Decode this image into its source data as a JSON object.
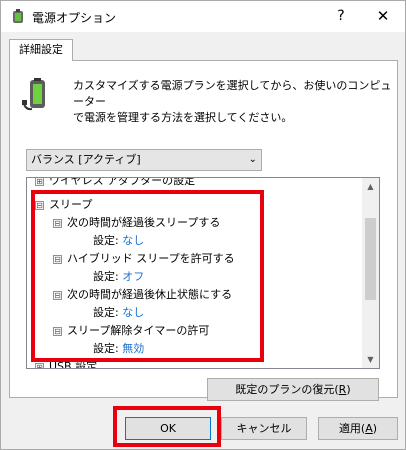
{
  "window": {
    "title": "電源オプション",
    "help_glyph": "?",
    "close_glyph": "✕"
  },
  "tab": {
    "label": "詳細設定"
  },
  "description": {
    "line1": "カスタマイズする電源プランを選択してから、お使いのコンピューター",
    "line2": "で電源を管理する方法を選択してください。"
  },
  "plan_select": {
    "value": "バランス [アクティブ]"
  },
  "tree": {
    "top_partial": "ワイヤレス アダプターの設定",
    "group_label": "スリープ",
    "setting_prefix": "設定:",
    "items": [
      {
        "label": "次の時間が経過後スリープする",
        "value": "なし"
      },
      {
        "label": "ハイブリッド スリープを許可する",
        "value": "オフ"
      },
      {
        "label": "次の時間が経過後休止状態にする",
        "value": "なし"
      },
      {
        "label": "スリープ解除タイマーの許可",
        "value": "無効"
      }
    ],
    "bottom_partial": "USB 設定",
    "expanded_glyph": "⊟",
    "collapsed_glyph": "⊞"
  },
  "buttons": {
    "restore_label": "既定のプランの復元(",
    "restore_key": "R",
    "restore_end": ")",
    "ok_label": "OK",
    "cancel_label": "キャンセル",
    "apply_label": "適用(",
    "apply_key": "A",
    "apply_end": ")"
  },
  "colors": {
    "highlight": "#e8000d",
    "value_link": "#1a6fd1"
  }
}
